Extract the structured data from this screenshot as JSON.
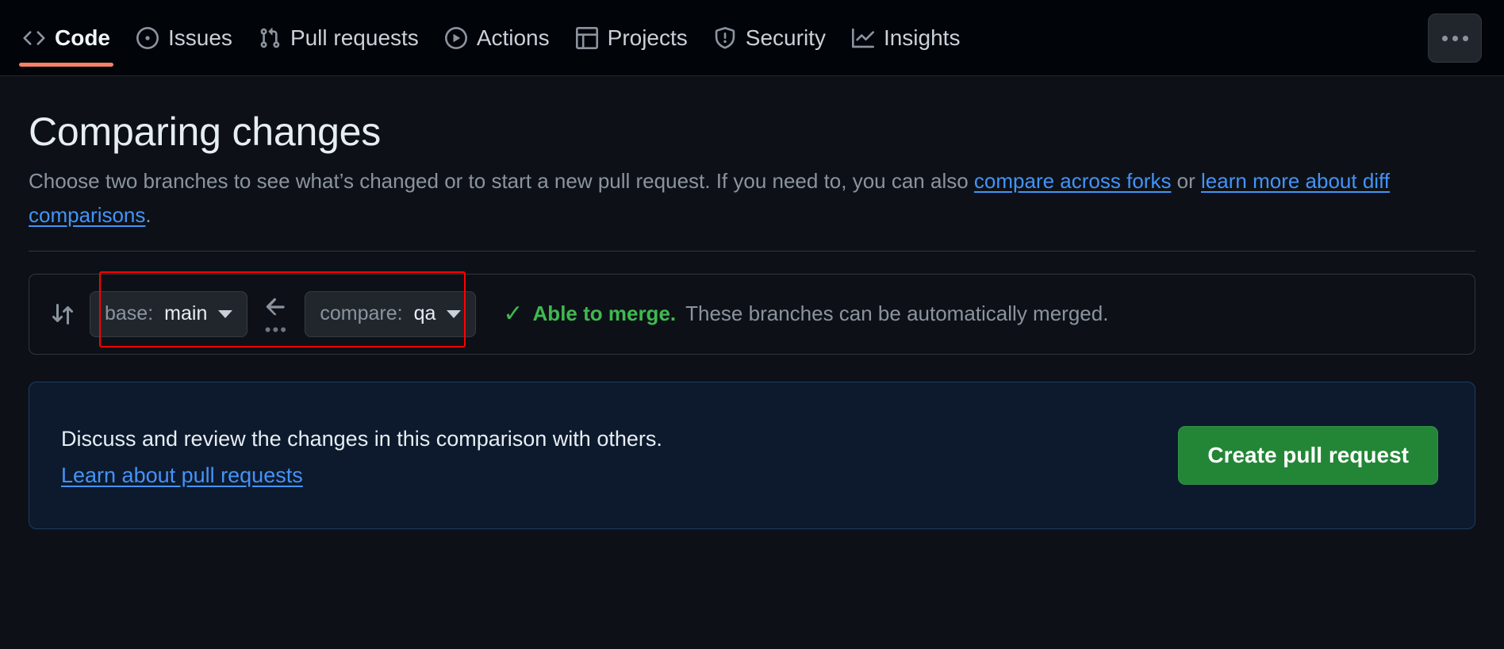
{
  "repo_nav": {
    "items": [
      {
        "label": "Code",
        "icon": "code-icon",
        "selected": true
      },
      {
        "label": "Issues",
        "icon": "issue-opened-icon",
        "selected": false
      },
      {
        "label": "Pull requests",
        "icon": "git-pull-request-icon",
        "selected": false
      },
      {
        "label": "Actions",
        "icon": "play-icon",
        "selected": false
      },
      {
        "label": "Projects",
        "icon": "table-icon",
        "selected": false
      },
      {
        "label": "Security",
        "icon": "shield-icon",
        "selected": false
      },
      {
        "label": "Insights",
        "icon": "graph-icon",
        "selected": false
      }
    ],
    "more_label": "More options",
    "selected_underline_color": "#f78166"
  },
  "page": {
    "title": "Comparing changes",
    "description_before": "Choose two branches to see what’s changed or to start a new pull request. If you need to, you can also ",
    "link_forks": "compare across forks",
    "description_or": " or ",
    "link_diffs": "learn more about diff comparisons",
    "description_end": "."
  },
  "compare_bar": {
    "compare_icon": "git-compare-icon",
    "base": {
      "prefix": "base: ",
      "branch": "main"
    },
    "compare": {
      "prefix": "compare: ",
      "branch": "qa"
    },
    "swap_icon": "arrow-left-icon",
    "swap_dots": "•••",
    "status": {
      "check_icon": "check-icon",
      "headline": "Able to merge.",
      "detail": " These branches can be automatically merged.",
      "color": "#3fb950"
    },
    "highlight_color": "#ff0000"
  },
  "discuss_panel": {
    "text": "Discuss and review the changes in this comparison with others.",
    "link": "Learn about pull requests",
    "button": "Create pull request",
    "button_color": "#238636"
  }
}
